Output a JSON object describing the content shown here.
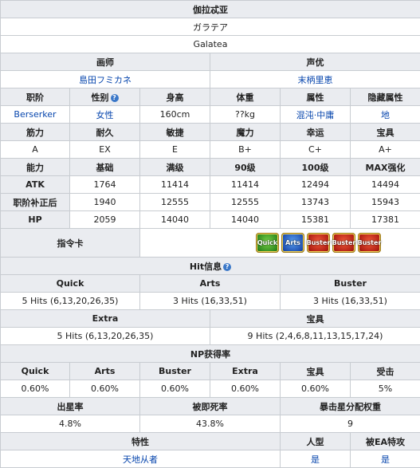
{
  "name_cn": "伽拉忒亚",
  "name_jp": "ガラテア",
  "name_en": "Galatea",
  "labels": {
    "illustrator": "画师",
    "cv": "声优",
    "class": "职阶",
    "gender": "性别",
    "height": "身高",
    "weight": "体重",
    "attribute": "属性",
    "hidden_attr": "隐藏属性",
    "strength": "筋力",
    "endurance": "耐久",
    "agility": "敏捷",
    "mana": "魔力",
    "luck": "幸运",
    "np": "宝具",
    "stat": "能力",
    "base": "基础",
    "max": "满级",
    "lv90": "90级",
    "lv100": "100级",
    "max_boost": "MAX强化",
    "atk": "ATK",
    "class_adj": "职阶补正后",
    "hp": "HP",
    "command_cards": "指令卡",
    "hit_info": "Hit信息",
    "quick": "Quick",
    "arts": "Arts",
    "buster": "Buster",
    "extra": "Extra",
    "np_gain": "NP获得率",
    "defense": "受击",
    "star_gen": "出星率",
    "death_rate": "被即死率",
    "star_weight": "暴击星分配权重",
    "traits": "特性",
    "humanoid": "人型",
    "ea_special": "被EA特攻"
  },
  "illustrator": "島田フミカネ",
  "cv": "末柄里恵",
  "class_name": "Berserker",
  "gender": "女性",
  "height": "160cm",
  "weight": "??kg",
  "attribute": "混沌·中庸",
  "hidden_attr": "地",
  "params": {
    "strength": "A",
    "endurance": "EX",
    "agility": "E",
    "mana": "B+",
    "luck": "C+",
    "np": "A+"
  },
  "stats": {
    "atk": [
      "1764",
      "11414",
      "11414",
      "12494",
      "14494"
    ],
    "class_adj": [
      "1940",
      "12555",
      "12555",
      "13743",
      "15943"
    ],
    "hp": [
      "2059",
      "14040",
      "14040",
      "15381",
      "17381"
    ]
  },
  "cards": [
    {
      "type": "quick",
      "label": "Quick"
    },
    {
      "type": "arts",
      "label": "Arts"
    },
    {
      "type": "buster",
      "label": "Buster"
    },
    {
      "type": "buster",
      "label": "Buster"
    },
    {
      "type": "buster",
      "label": "Buster"
    }
  ],
  "hits": {
    "quick": "5 Hits (6,13,20,26,35)",
    "arts": "3 Hits (16,33,51)",
    "buster": "3 Hits (16,33,51)",
    "extra": "5 Hits (6,13,20,26,35)",
    "np": "9 Hits (2,4,6,8,11,13,15,17,24)"
  },
  "np_rates": {
    "quick": "0.60%",
    "arts": "0.60%",
    "buster": "0.60%",
    "extra": "0.60%",
    "np": "0.60%",
    "defense": "5%"
  },
  "star_gen": "4.8%",
  "death_rate": "43.8%",
  "star_weight": "9",
  "traits": "天地从者",
  "humanoid": "是",
  "ea_special": "是",
  "help_icon": "question-circle-icon",
  "colors": {
    "header_bg": "#eaecf0",
    "link": "#0645ad",
    "border": "#c8ccd1"
  }
}
